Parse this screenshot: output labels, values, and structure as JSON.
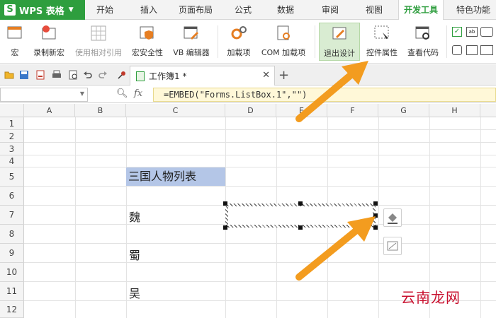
{
  "app": {
    "name": "WPS 表格",
    "logo_letter": "S"
  },
  "menu": [
    "开始",
    "插入",
    "页面布局",
    "公式",
    "数据",
    "审阅",
    "视图",
    "开发工具",
    "特色功能"
  ],
  "menu_active": "开发工具",
  "ribbon": {
    "macro": "宏",
    "record_macro": "录制新宏",
    "relative_ref": "使用相对引用",
    "macro_security": "宏安全性",
    "vb_editor": "VB 编辑器",
    "addins": "加载项",
    "com_addins": "COM 加载项",
    "exit_design": "退出设计",
    "control_props": "控件属性",
    "view_code": "查看代码"
  },
  "document": {
    "tab_label": "工作簿1 *"
  },
  "formula_bar": {
    "formula": "=EMBED(\"Forms.ListBox.1\",\"\")"
  },
  "grid": {
    "columns": [
      "A",
      "B",
      "C",
      "D",
      "E",
      "F",
      "G",
      "H"
    ],
    "rows": [
      "1",
      "2",
      "3",
      "4",
      "5",
      "6",
      "7",
      "8",
      "9",
      "10",
      "11",
      "12"
    ],
    "cells": {
      "C5": "三国人物列表",
      "C7": "魏",
      "C9": "蜀",
      "C11": "吴"
    }
  },
  "watermark": "云南龙网",
  "colors": {
    "wps_green": "#2e9e3e",
    "header_fill": "#b4c6e7",
    "arrow": "#f39c1f"
  }
}
